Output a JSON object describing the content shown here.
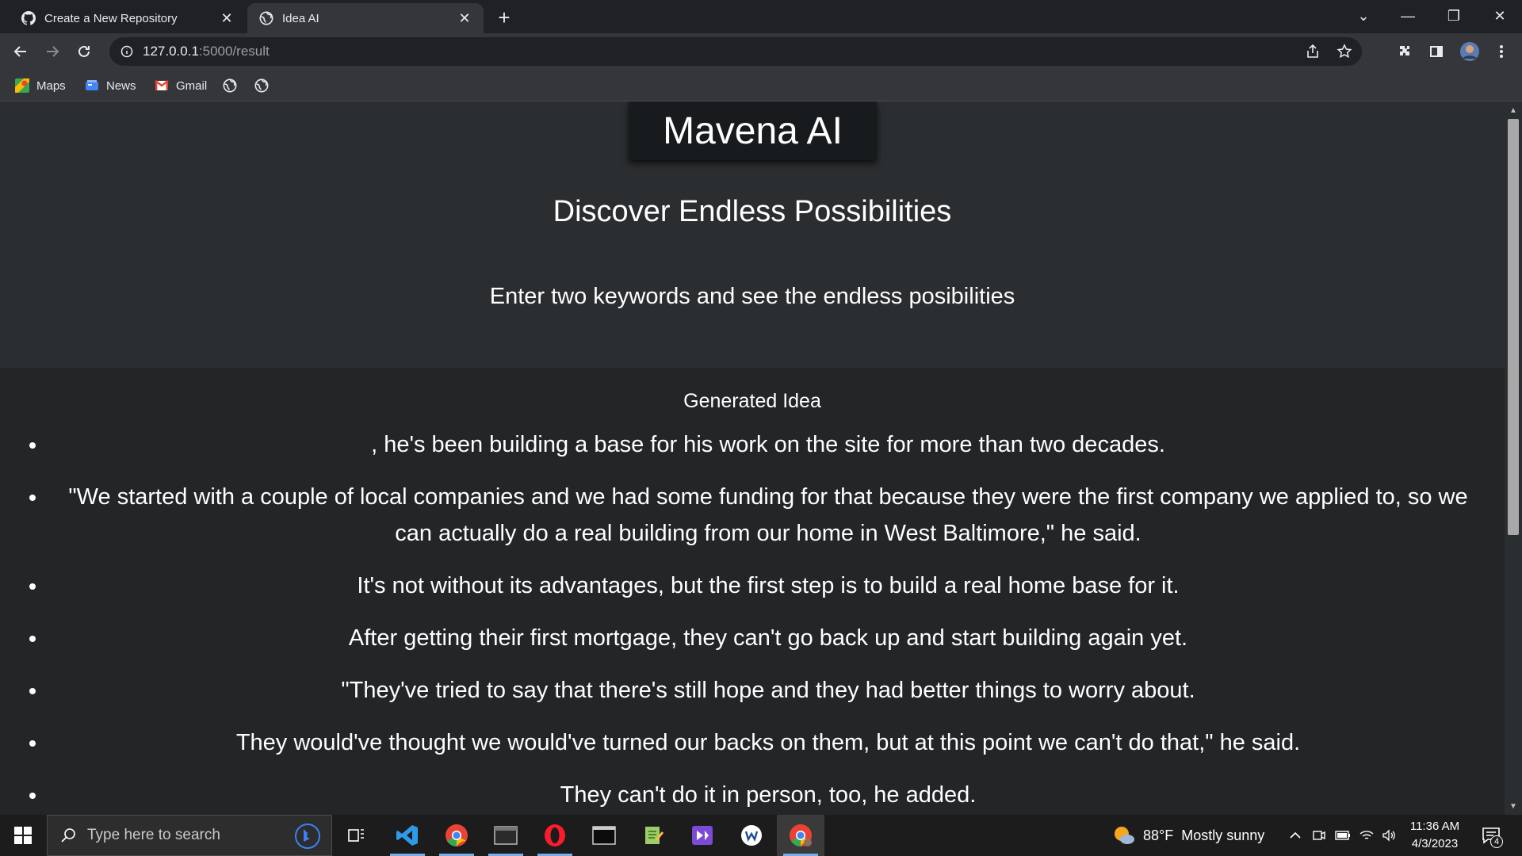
{
  "browser": {
    "tabs": [
      {
        "title": "Create a New Repository",
        "icon": "github-icon"
      },
      {
        "title": "Idea AI",
        "icon": "globe-icon"
      }
    ],
    "address": {
      "host": "127.0.0.1",
      "path": ":5000/result"
    },
    "bookmarks": [
      {
        "label": "Maps",
        "icon": "maps-icon"
      },
      {
        "label": "News",
        "icon": "news-icon"
      },
      {
        "label": "Gmail",
        "icon": "gmail-icon"
      }
    ]
  },
  "page": {
    "brand": "Mavena AI",
    "headline": "Discover Endless Possibilities",
    "subline": "Enter two keywords and see the endless posibilities",
    "results_title": "Generated Idea",
    "ideas": [
      ", he's been building a base for his work on the site for more than two decades.",
      "\"We started with a couple of local companies and we had some funding for that because they were the first company we applied to, so we can actually do a real building from our home in West Baltimore,\" he said.",
      "It's not without its advantages, but the first step is to build a real home base for it.",
      "After getting their first mortgage, they can't go back up and start building again yet.",
      "\"They've tried to say that there's still hope and they had better things to worry about.",
      "They would've thought we would've turned our backs on them, but at this point we can't do that,\" he said.",
      "They can't do it in person, too, he added."
    ]
  },
  "taskbar": {
    "search_placeholder": "Type here to search",
    "weather": {
      "temp": "88°F",
      "condition": "Mostly sunny"
    },
    "time": "11:36 AM",
    "date": "4/3/2023",
    "notification_count": "4"
  },
  "colors": {
    "page_bg": "#2b2e30",
    "results_bg": "#232527",
    "brand_bg": "#181b1d",
    "chrome_bg": "#35363a"
  }
}
